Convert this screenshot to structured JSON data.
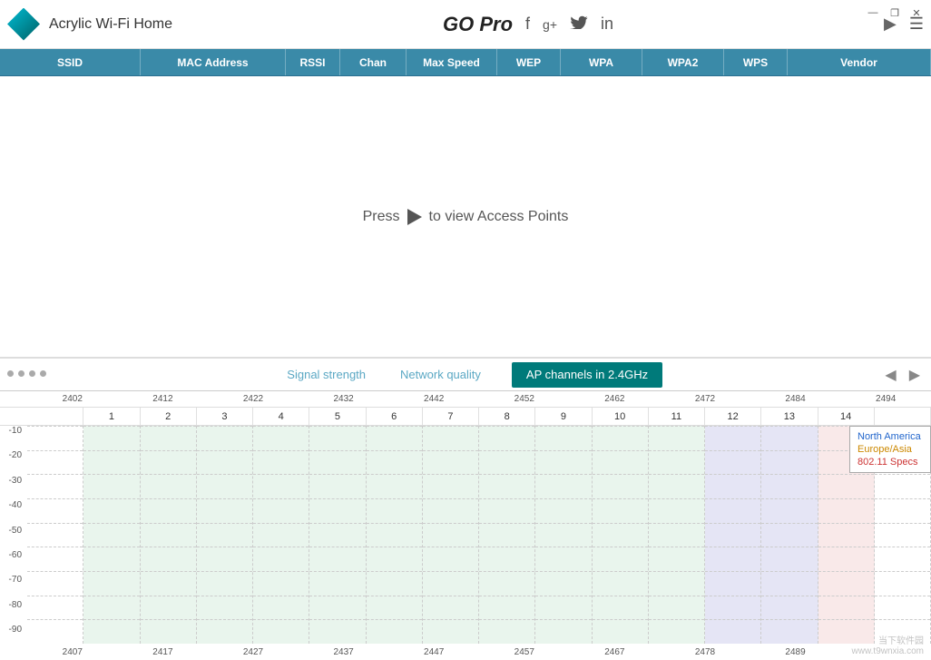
{
  "app": {
    "title": "Acrylic Wi-Fi Home",
    "logo_alt": "diamond logo"
  },
  "gopro": {
    "label": "GO Pro"
  },
  "social": {
    "facebook": "f",
    "googleplus": "g+",
    "twitter": "✦",
    "linkedin": "in"
  },
  "window_controls": {
    "minimize": "—",
    "restore": "❐",
    "close": "✕"
  },
  "columns": {
    "headers": [
      "SSID",
      "MAC Address",
      "RSSI",
      "Chan",
      "Max Speed",
      "WEP",
      "WPA",
      "WPA2",
      "WPS",
      "Vendor"
    ]
  },
  "ap_area": {
    "press_label": "Press",
    "to_label": "to view Access Points"
  },
  "tabs": {
    "signal_strength": "Signal strength",
    "network_quality": "Network quality",
    "ap_channels": "AP channels in 2.4GHz",
    "nav_left": "◀",
    "nav_right": "▶"
  },
  "chart": {
    "freq_top": [
      "2402",
      "2412",
      "2422",
      "2432",
      "2442",
      "2452",
      "2462",
      "2472",
      "2484",
      "2494"
    ],
    "channels": [
      "",
      "1",
      "2",
      "3",
      "4",
      "5",
      "6",
      "7",
      "8",
      "9",
      "10",
      "11",
      "12",
      "13",
      "14",
      ""
    ],
    "y_labels": [
      "-10",
      "-20",
      "-30",
      "-40",
      "-50",
      "-60",
      "-70",
      "-80",
      "-90"
    ],
    "freq_bottom": [
      "2407",
      "2417",
      "2427",
      "2437",
      "2447",
      "2457",
      "2467",
      "2478",
      "2489",
      ""
    ],
    "legend": {
      "north_america": "North America",
      "europe_asia": "Europe/Asia",
      "specs": "802.11 Specs"
    }
  },
  "watermark": {
    "line1": "当下软件园",
    "line2": "www.t9wnxia.com"
  }
}
